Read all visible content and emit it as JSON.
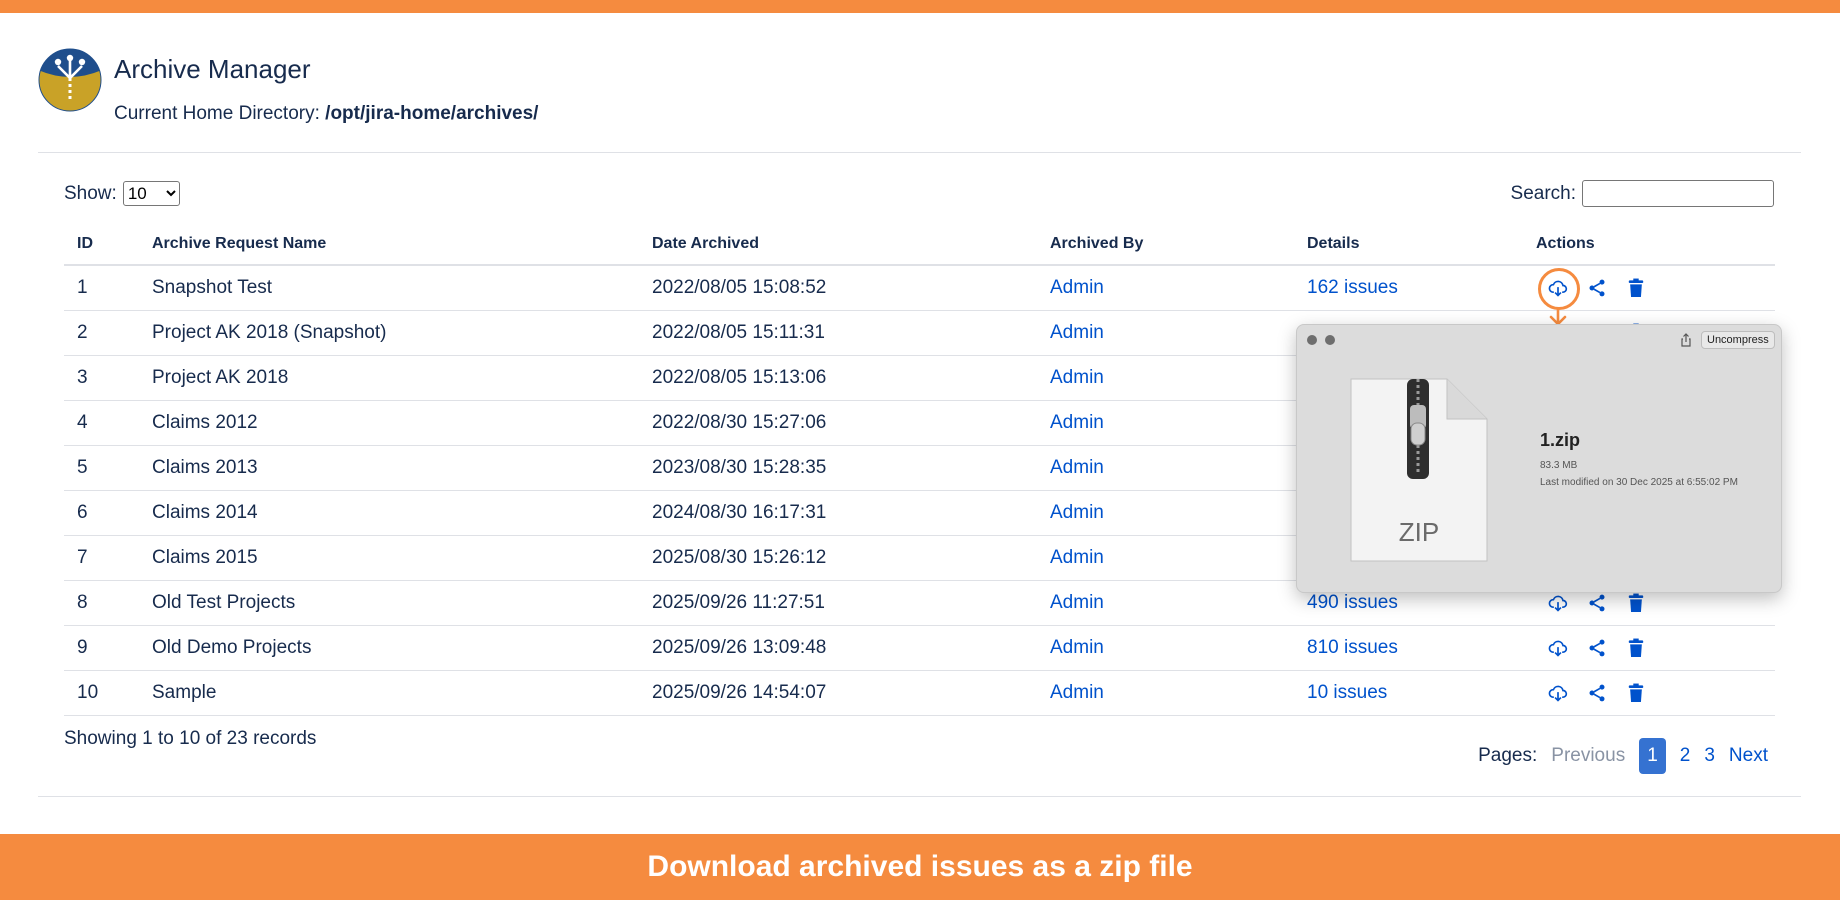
{
  "app": {
    "title": "Archive Manager",
    "home_label": "Current Home Directory:",
    "home_path": "/opt/jira-home/archives/"
  },
  "controls": {
    "show_label": "Show:",
    "show_value": "10",
    "search_label": "Search:",
    "search_value": ""
  },
  "table": {
    "headers": [
      "ID",
      "Archive Request Name",
      "Date Archived",
      "Archived By",
      "Details",
      "Actions"
    ],
    "rows": [
      {
        "id": "1",
        "name": "Snapshot Test",
        "date": "2022/08/05 15:08:52",
        "by": "Admin",
        "details": "162 issues"
      },
      {
        "id": "2",
        "name": "Project AK 2018 (Snapshot)",
        "date": "2022/08/05 15:11:31",
        "by": "Admin",
        "details": ""
      },
      {
        "id": "3",
        "name": "Project AK 2018",
        "date": "2022/08/05 15:13:06",
        "by": "Admin",
        "details": ""
      },
      {
        "id": "4",
        "name": "Claims 2012",
        "date": "2022/08/30 15:27:06",
        "by": "Admin",
        "details": ""
      },
      {
        "id": "5",
        "name": "Claims 2013",
        "date": "2023/08/30 15:28:35",
        "by": "Admin",
        "details": ""
      },
      {
        "id": "6",
        "name": "Claims 2014",
        "date": "2024/08/30 16:17:31",
        "by": "Admin",
        "details": ""
      },
      {
        "id": "7",
        "name": "Claims 2015",
        "date": "2025/08/30 15:26:12",
        "by": "Admin",
        "details": ""
      },
      {
        "id": "8",
        "name": "Old Test Projects",
        "date": "2025/09/26 11:27:51",
        "by": "Admin",
        "details": "490 issues"
      },
      {
        "id": "9",
        "name": "Old Demo Projects",
        "date": "2025/09/26 13:09:48",
        "by": "Admin",
        "details": "810 issues"
      },
      {
        "id": "10",
        "name": "Sample",
        "date": "2025/09/26 14:54:07",
        "by": "Admin",
        "details": "10 issues"
      }
    ]
  },
  "footer": {
    "showing": "Showing 1 to 10 of 23 records",
    "pages_label": "Pages:",
    "previous": "Previous",
    "pages": [
      "1",
      "2",
      "3"
    ],
    "current_page": "1",
    "next": "Next"
  },
  "preview": {
    "button": "Uncompress",
    "file_name": "1.zip",
    "file_size": "83.3 MB",
    "modified": "Last modified on 30 Dec 2025 at 6:55:02 PM",
    "icon_label": "ZIP"
  },
  "banner": "Download archived issues as a zip file",
  "icons": [
    "archive-logo-icon",
    "download-cloud-icon",
    "share-icon",
    "trash-icon",
    "zip-file-icon"
  ],
  "colors": {
    "accent": "#f58b3f",
    "link": "#0052cc",
    "current_page": "#3572d1"
  }
}
